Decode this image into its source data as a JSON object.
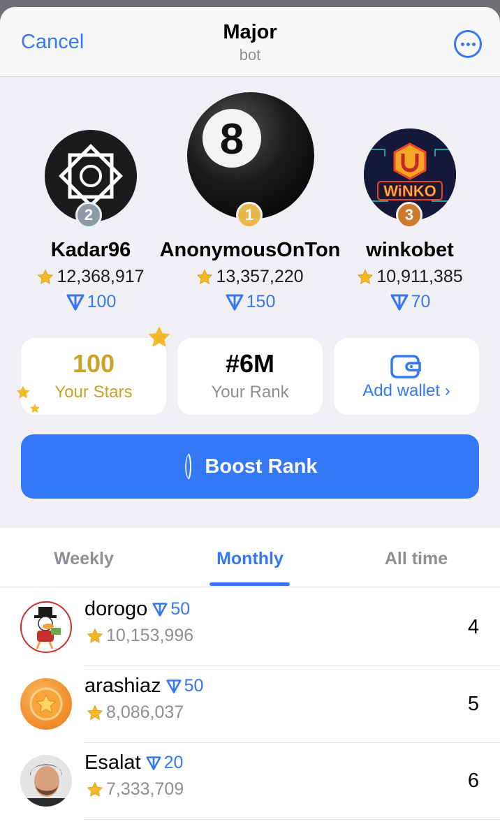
{
  "header": {
    "cancel_label": "Cancel",
    "title": "Major",
    "subtitle": "bot"
  },
  "podium": [
    {
      "place": "2",
      "name": "Kadar96",
      "stars": "12,368,917",
      "ton": "100",
      "badge_color": "#8e9aa6"
    },
    {
      "place": "1",
      "name": "AnonymousOnTon",
      "stars": "13,357,220",
      "ton": "150",
      "badge_color": "#e8b94a"
    },
    {
      "place": "3",
      "name": "winkobet",
      "stars": "10,911,385",
      "ton": "70",
      "badge_color": "#cc7a2c"
    }
  ],
  "cards": {
    "stars_value": "100",
    "stars_label": "Your Stars",
    "rank_value": "#6M",
    "rank_label": "Your Rank",
    "wallet_label": "Add wallet ›"
  },
  "boost_label": "Boost Rank",
  "tabs": [
    {
      "label": "Weekly",
      "active": false
    },
    {
      "label": "Monthly",
      "active": true
    },
    {
      "label": "All time",
      "active": false
    }
  ],
  "rows": [
    {
      "name": "dorogo",
      "ton": "50",
      "stars": "10,153,996",
      "rank": "4"
    },
    {
      "name": "arashiaz",
      "ton": "50",
      "stars": "8,086,037",
      "rank": "5"
    },
    {
      "name": "Esalat",
      "ton": "20",
      "stars": "7,333,709",
      "rank": "6"
    }
  ],
  "colors": {
    "accent": "#3478f6",
    "gold": "#c9a227",
    "star": "#f2b928"
  }
}
